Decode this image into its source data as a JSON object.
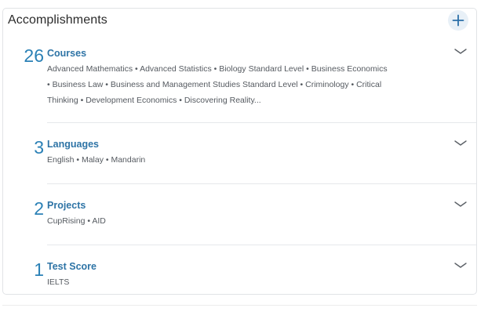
{
  "header": {
    "title": "Accomplishments",
    "add_icon": "plus-icon"
  },
  "sections": [
    {
      "count": "26",
      "title": "Courses",
      "items": [
        "Advanced Mathematics",
        "Advanced Statistics",
        "Biology Standard Level",
        "Business Economics",
        "Business Law",
        "Business and Management Studies Standard Level",
        "Criminology",
        "Critical Thinking",
        "Development Economics",
        "Discovering Reality..."
      ],
      "lines": [
        "Advanced Mathematics • Advanced Statistics • Biology Standard Level • Business Economics",
        "• Business Law • Business and Management Studies Standard Level • Criminology • Critical",
        "Thinking • Development Economics • Discovering Reality..."
      ],
      "expand_icon": "chevron-down-icon"
    },
    {
      "count": "3",
      "title": "Languages",
      "lines": [
        "English • Malay • Mandarin"
      ],
      "expand_icon": "chevron-down-icon"
    },
    {
      "count": "2",
      "title": "Projects",
      "lines": [
        "CupRising • AID"
      ],
      "expand_icon": "chevron-down-icon"
    },
    {
      "count": "1",
      "title": "Test Score",
      "lines": [
        "IELTS"
      ],
      "expand_icon": "chevron-down-icon"
    }
  ],
  "colors": {
    "accent": "#2b81b6",
    "section_title": "#2e74a6",
    "text": "#555a60"
  }
}
